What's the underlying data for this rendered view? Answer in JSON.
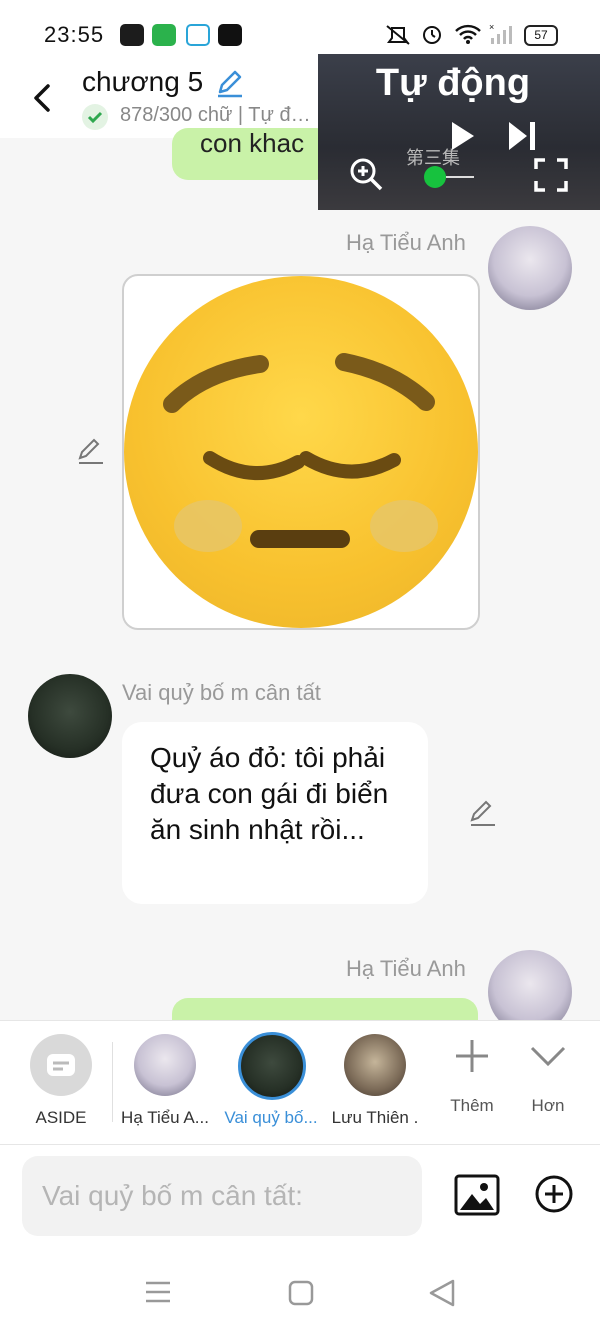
{
  "status_bar": {
    "time": "23:55",
    "battery": "57"
  },
  "header": {
    "title": "chương 5",
    "subtitle": "878/300 chữ | Tự đ…"
  },
  "video_overlay": {
    "title": "Tự động",
    "watermark": "第三集"
  },
  "messages": [
    {
      "sender": "Hạ Tiểu Anh",
      "partial_text": "con khac",
      "side": "right"
    },
    {
      "sender": "Hạ Tiểu Anh",
      "type": "image",
      "side": "right"
    },
    {
      "sender": "Vai quỷ bố m cân tất",
      "text": "Quỷ áo đỏ: tôi phải đưa con gái đi biển ăn sinh nhật rồi...",
      "side": "left"
    },
    {
      "sender": "Hạ Tiểu Anh",
      "side": "right"
    }
  ],
  "character_bar": {
    "items": [
      {
        "label": "ASIDE"
      },
      {
        "label": "Hạ Tiểu A..."
      },
      {
        "label": "Vai quỷ bố..."
      },
      {
        "label": "Lưu Thiên ."
      },
      {
        "label": "Thêm"
      },
      {
        "label": "Hơn"
      }
    ],
    "active_color": "#3a8fd8"
  },
  "input": {
    "placeholder": "Vai quỷ bố m cân tất:"
  }
}
